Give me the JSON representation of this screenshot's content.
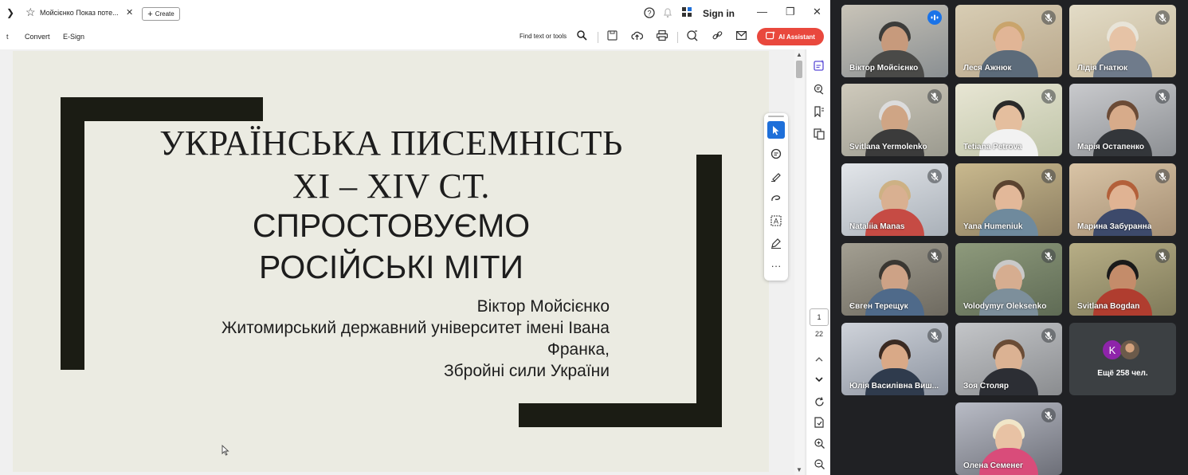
{
  "tabbar": {
    "tab_title": "Мойсієнко Показ поте...",
    "create_label": "Create",
    "sign_in": "Sign in"
  },
  "toolbar": {
    "truncated_item": "t",
    "convert": "Convert",
    "esign": "E-Sign",
    "find": "Find text or tools",
    "ai_assistant": "AI Assistant"
  },
  "slide": {
    "title_line1": "УКРАЇНСЬКА ПИСЕМНІСТЬ",
    "title_line2": "XI – XIV СТ.",
    "title_line3": "СПРОСТОВУЄМО",
    "title_line4": "РОСІЙСЬКІ МІТИ",
    "author": "Віктор Мойсієнко",
    "affiliation_line1": "Житомирський державний університет імені Івана",
    "affiliation_line2": "Франка,",
    "affiliation_line3": "Збройні сили України",
    "frame_color": "#1b1c14",
    "background": "#ebebe2"
  },
  "page_nav": {
    "current_page": "1",
    "total_pages": "22"
  },
  "meet": {
    "participants": [
      {
        "name": "Віктор Мойсієнко",
        "mic": "speaking"
      },
      {
        "name": "Леся Ажнюк",
        "mic": "muted"
      },
      {
        "name": "Лідія Гнатюк",
        "mic": "muted"
      },
      {
        "name": "Svitlana Yermolenko",
        "mic": "muted"
      },
      {
        "name": "Tetiana Petrova",
        "mic": "muted"
      },
      {
        "name": "Марія Остапенко",
        "mic": "muted"
      },
      {
        "name": "Nataliia Manas",
        "mic": "muted"
      },
      {
        "name": "Yana Humeniuk",
        "mic": "muted"
      },
      {
        "name": "Марина Забуранна",
        "mic": "muted"
      },
      {
        "name": "Євген Терещук",
        "mic": "muted"
      },
      {
        "name": "Volodymyr Oleksenko",
        "mic": "muted"
      },
      {
        "name": "Svitlana Bogdan",
        "mic": "muted"
      },
      {
        "name": "Юлія Василівна Виш...",
        "mic": "muted"
      },
      {
        "name": "Зоя Столяр",
        "mic": "muted"
      },
      {
        "name": "Олена Семенег",
        "mic": "muted"
      }
    ],
    "more_avatar_letter": "K",
    "more_label": "Ещё 258 чел.",
    "accent_color": "#8ab4f8"
  }
}
